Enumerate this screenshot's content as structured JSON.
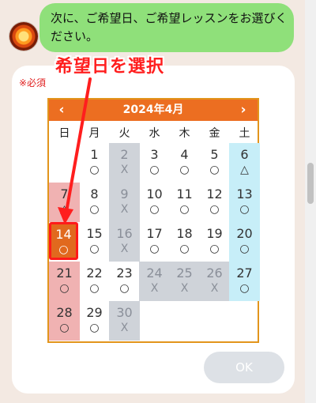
{
  "chat": {
    "message": "次に、ご希望日、ご希望レッスンをお選びください。"
  },
  "form": {
    "required_label": "※必須",
    "ok_label": "OK"
  },
  "annotation": {
    "text": "希望日を選択"
  },
  "calendar": {
    "month_label": "2024年4月",
    "prev_icon": "‹",
    "next_icon": "›",
    "weekdays": [
      "日",
      "月",
      "火",
      "水",
      "木",
      "金",
      "土"
    ],
    "days": [
      {
        "day": "1",
        "mark": "○"
      },
      {
        "day": "2",
        "mark": "X"
      },
      {
        "day": "3",
        "mark": "○"
      },
      {
        "day": "4",
        "mark": "○"
      },
      {
        "day": "5",
        "mark": "○"
      },
      {
        "day": "6",
        "mark": "△"
      },
      {
        "day": "7",
        "mark": "△"
      },
      {
        "day": "8",
        "mark": "○"
      },
      {
        "day": "9",
        "mark": "X"
      },
      {
        "day": "10",
        "mark": "○"
      },
      {
        "day": "11",
        "mark": "○"
      },
      {
        "day": "12",
        "mark": "○"
      },
      {
        "day": "13",
        "mark": "○"
      },
      {
        "day": "14",
        "mark": "○"
      },
      {
        "day": "15",
        "mark": "○"
      },
      {
        "day": "16",
        "mark": "X"
      },
      {
        "day": "17",
        "mark": "○"
      },
      {
        "day": "18",
        "mark": "○"
      },
      {
        "day": "19",
        "mark": "○"
      },
      {
        "day": "20",
        "mark": "○"
      },
      {
        "day": "21",
        "mark": "○"
      },
      {
        "day": "22",
        "mark": "○"
      },
      {
        "day": "23",
        "mark": "○"
      },
      {
        "day": "24",
        "mark": "X"
      },
      {
        "day": "25",
        "mark": "X"
      },
      {
        "day": "26",
        "mark": "X"
      },
      {
        "day": "27",
        "mark": "○"
      },
      {
        "day": "28",
        "mark": "○"
      },
      {
        "day": "29",
        "mark": "○"
      },
      {
        "day": "30",
        "mark": "X"
      }
    ]
  },
  "colors": {
    "header": "#ec6e21",
    "border": "#e2951c",
    "closed": "#cfd3d9",
    "sunday": "#f0b2b2",
    "saturday": "#c7eef8",
    "selected_fill": "#e1691e",
    "selected_outline": "#ff1a1a"
  }
}
